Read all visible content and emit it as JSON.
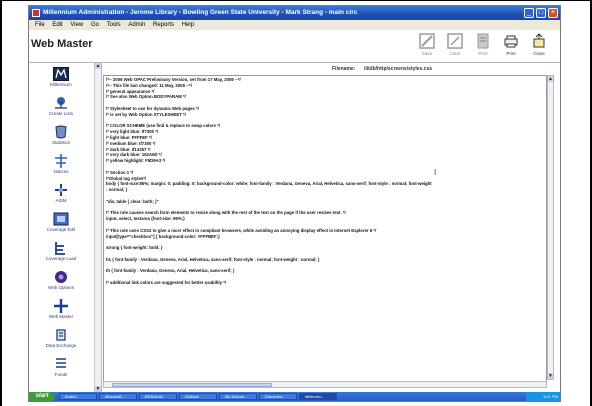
{
  "window": {
    "title": "Millennium Administration - Jerome Library - Bowling Green State University - Mark Strang - main circ"
  },
  "menu": [
    "File",
    "Edit",
    "View",
    "Go",
    "Tools",
    "Admin",
    "Reports",
    "Help"
  ],
  "header": {
    "title": "Web Master",
    "tools": [
      {
        "label": "Save",
        "icon": "save-icon"
      },
      {
        "label": "Clear",
        "icon": "clear-icon"
      },
      {
        "label": "Print",
        "icon": "print-icon"
      },
      {
        "label": "Print",
        "icon": "printer-icon"
      },
      {
        "label": "Close",
        "icon": "close-door-icon"
      }
    ]
  },
  "sidebar": {
    "items": [
      {
        "label": "Millennium",
        "icon": "millennium-icon"
      },
      {
        "label": "Create Lists",
        "icon": "create-lists-icon"
      },
      {
        "label": "Statistics",
        "icon": "statistics-icon"
      },
      {
        "label": "Notices",
        "icon": "notices-icon"
      },
      {
        "label": "AISM",
        "icon": "aism-icon"
      },
      {
        "label": "Coverage Edit",
        "icon": "coverage-edit-icon"
      },
      {
        "label": "Coverage Load",
        "icon": "coverage-load-icon"
      },
      {
        "label": "Web Options",
        "icon": "web-options-icon"
      },
      {
        "label": "Web Master",
        "icon": "web-master-icon"
      },
      {
        "label": "Data Exchange",
        "icon": "data-exchange-icon"
      },
      {
        "label": "Funds",
        "icon": "funds-icon"
      }
    ]
  },
  "file": {
    "label": "Filename:",
    "value": "/iiidb/http/screens/styles.css"
  },
  "code_lines": [
    "/*-- 2006 Web OPAC Preliminary Version, set from 17 May, 2006 --*/",
    "/*-- This file last changed: 11 May, 2006 --*/",
    "/* general appearance */",
    "/* See also Web Option BODYPARAM */",
    "",
    "/* Stylesheet to use for dynamic Web pages */",
    "/* is set by Web Option STYLESHEET */",
    "",
    "/* COLOR SCHEME (use find & replace to swap colors */",
    "/* very light blue: If7300 */",
    "/* light blue: FFFFEF */",
    "/* medium blue: If7300 */",
    "/* dark blue: If13267 */",
    "/* very dark blue: 162A6D */",
    "/* yellow highlight: F5D9A3 */",
    "",
    "/* Section 1 */",
    "/*Global tag styles*/",
    "body { font-size:85%; margin: 0; padding: 0; background-color: white; font-family : Verdana, Geneva, Arial, Helvetica, sans-serif; font-style : normal; font-weight",
    ": normal; }",
    "",
    "\"div, table { clear: both; }\"",
    "",
    "/* This rule causes search form elements to resize along with the rest of the text on the page if the user resizes text. */",
    "input, select, textarea {font-size: 95%;}",
    "",
    "/* This rule uses CSS2 to give a nicer effect in compliant browsers, while avoiding an annoying display effect in Internet Explorer 6 */",
    "input[type=\"checkbox\"] { background-color: #FFFBEF;}",
    "",
    "strong { font-weight: bold; }",
    "",
    "h1 { font-family : Verdana, Geneva, Arial, Helvetica, sans-serif; font-style : normal; font-weight : normal; }",
    "",
    "th { font-family : Verdana, Geneva, Arial, Helvetica, sans-serif; }",
    "",
    "/* additional link colors are suggested for better usability */"
  ],
  "taskbar": {
    "start": "start",
    "tasks": [
      "Bolero",
      "Microsoft...",
      "BGSUinfo",
      "Outlook",
      "My Docum...",
      "Documen...",
      "Millenniu..."
    ],
    "clock": "3:21 PM"
  }
}
